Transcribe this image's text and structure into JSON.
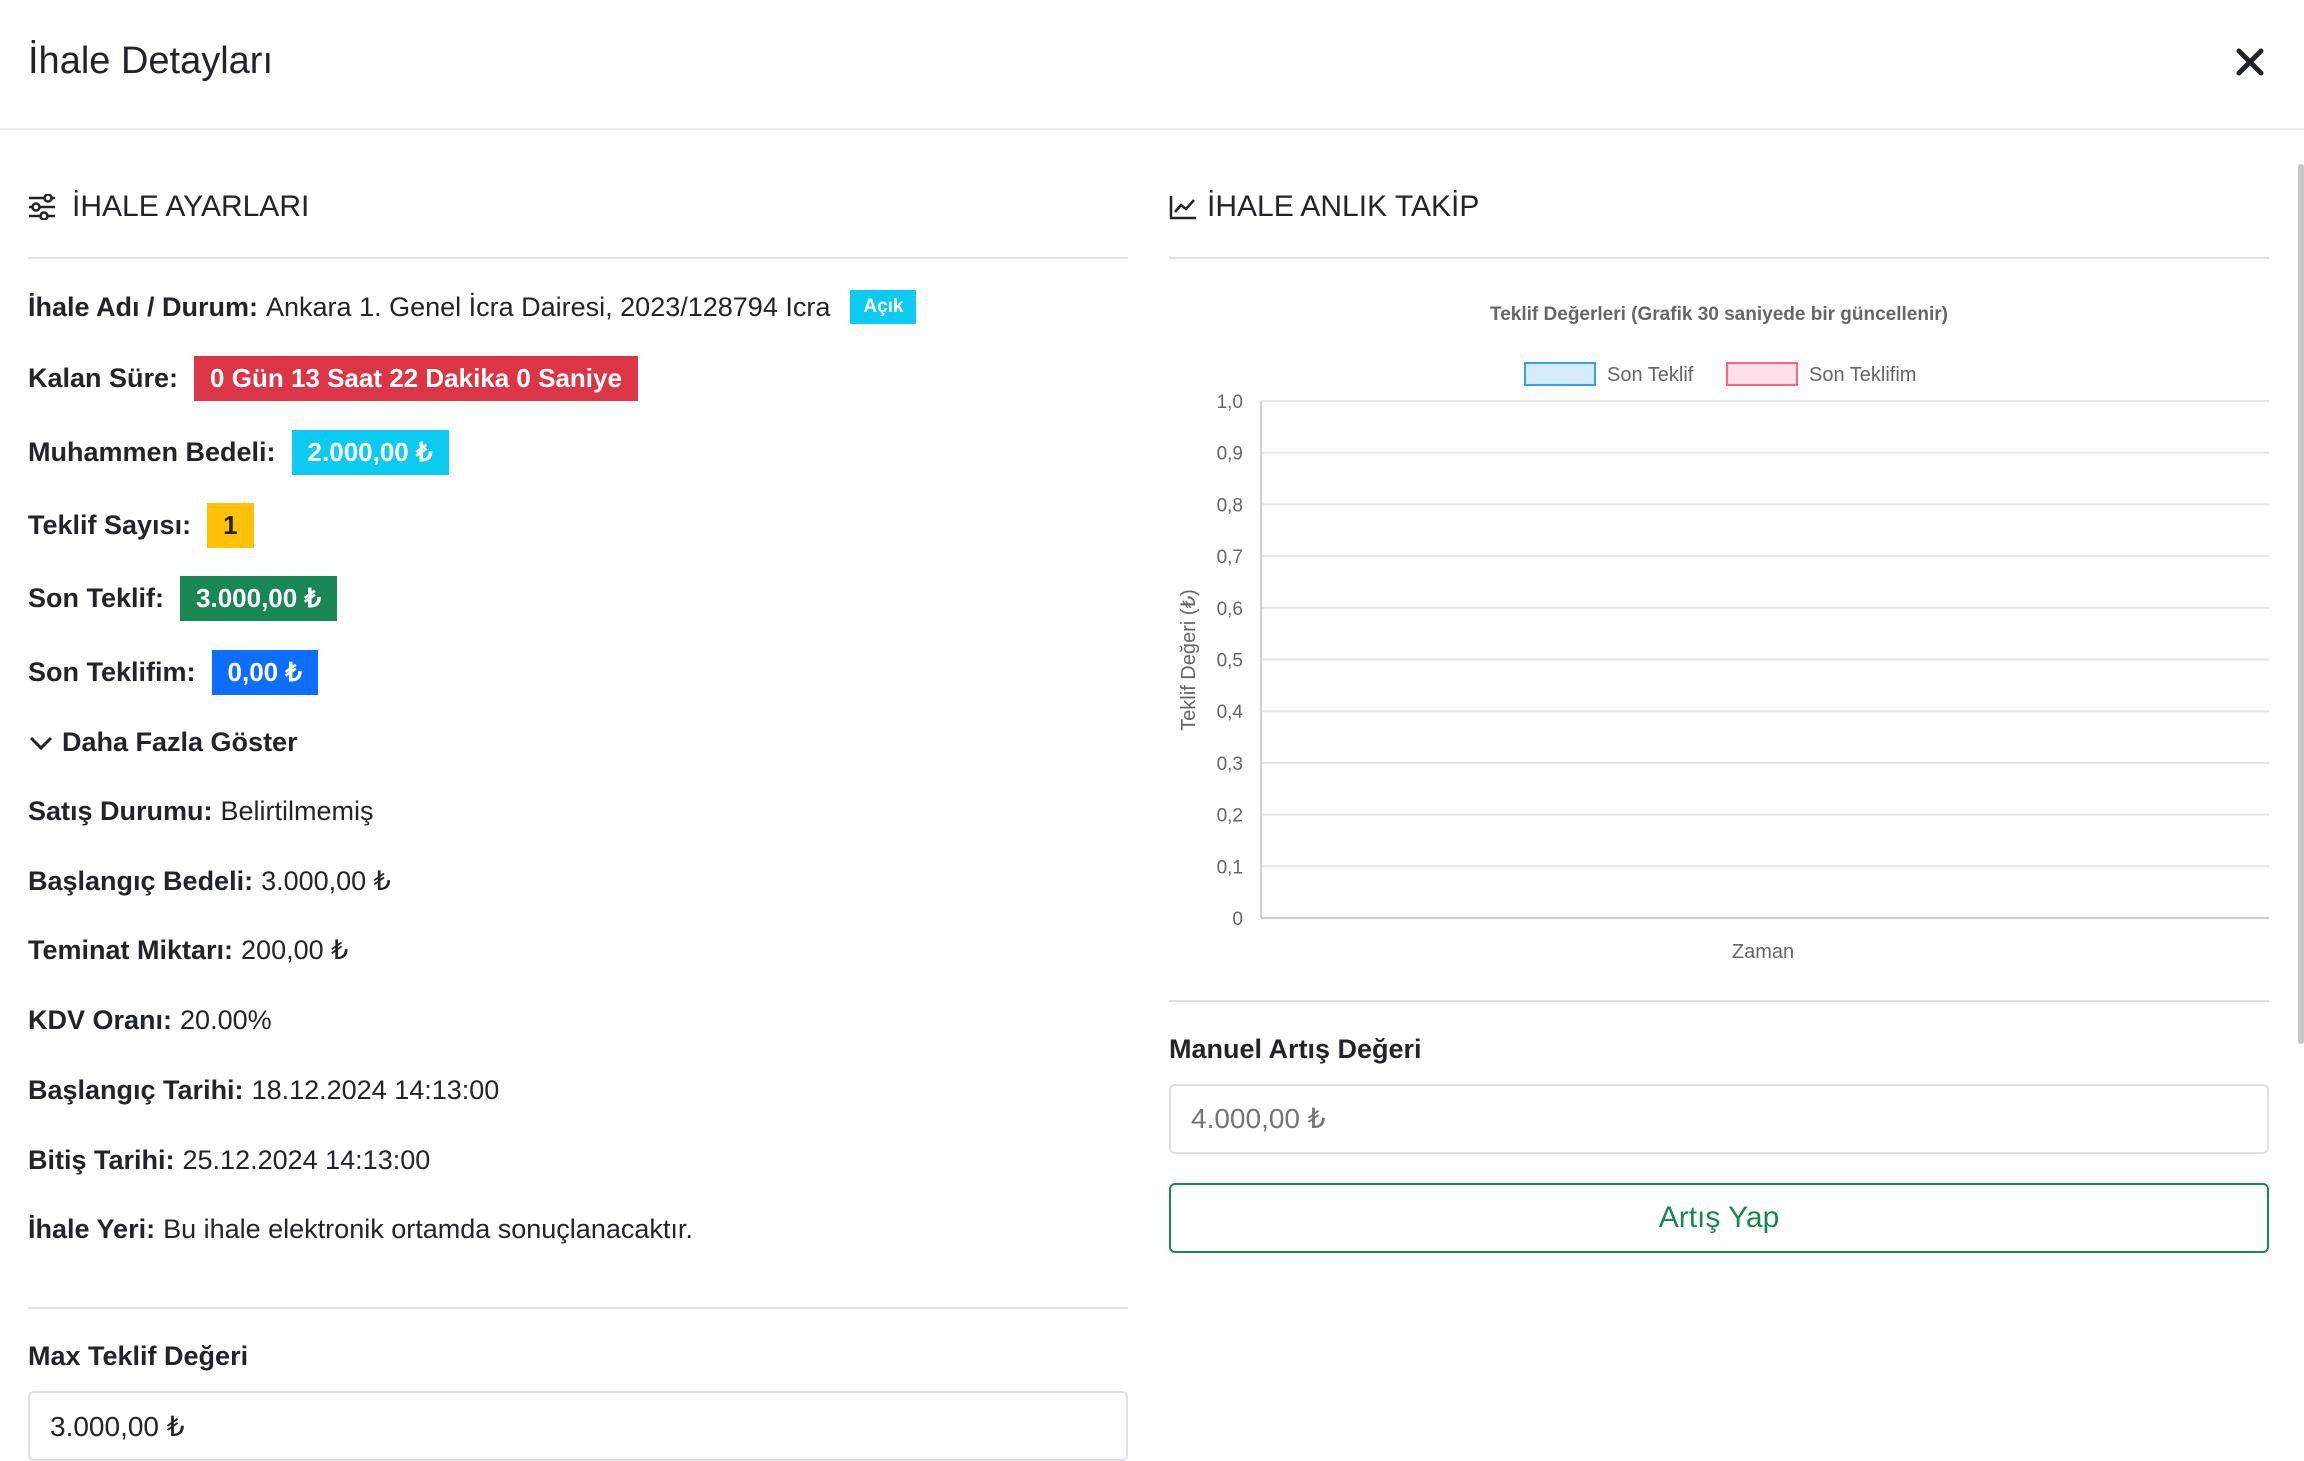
{
  "modal": {
    "title": "İhale Detayları"
  },
  "settings": {
    "title": "İHALE AYARLARI",
    "rows": {
      "name": {
        "label": "İhale Adı / Durum:",
        "value": "Ankara 1. Genel İcra Dairesi, 2023/128794 Icra",
        "status": "Açık"
      },
      "remaining": {
        "label": "Kalan Süre:",
        "value": "0 Gün 13 Saat 22 Dakika 0 Saniye"
      },
      "estimated": {
        "label": "Muhammen Bedeli:",
        "value": "2.000,00 ₺"
      },
      "bid_count": {
        "label": "Teklif Sayısı:",
        "value": "1"
      },
      "last_bid": {
        "label": "Son Teklif:",
        "value": "3.000,00 ₺"
      },
      "my_last_bid": {
        "label": "Son Teklifim:",
        "value": "0,00 ₺"
      }
    },
    "show_more": "Daha Fazla Göster",
    "details": [
      {
        "label": "Satış Durumu:",
        "value": "Belirtilmemiş"
      },
      {
        "label": "Başlangıç Bedeli:",
        "value": "3.000,00 ₺"
      },
      {
        "label": "Teminat Miktarı:",
        "value": "200,00 ₺"
      },
      {
        "label": "KDV Oranı:",
        "value": "20.00%"
      },
      {
        "label": "Başlangıç Tarihi:",
        "value": "18.12.2024 14:13:00"
      },
      {
        "label": "Bitiş Tarihi:",
        "value": "25.12.2024 14:13:00"
      },
      {
        "label": "İhale Yeri:",
        "value": "Bu ihale elektronik ortamda sonuçlanacaktır."
      }
    ],
    "max_bid": {
      "label": "Max Teklif Değeri",
      "value": "3.000,00 ₺"
    }
  },
  "tracking": {
    "title": "İHALE ANLIK TAKİP",
    "manual": {
      "label": "Manuel Artış Değeri",
      "placeholder": "4.000,00 ₺"
    },
    "button": "Artış Yap"
  },
  "colors": {
    "danger": "#dc3545",
    "info": "#0dcaf0",
    "warning": "#ffc107",
    "success": "#198754",
    "primary": "#0d6efd"
  },
  "chart_data": {
    "type": "line",
    "title": "Teklif Değerleri (Grafik 30 saniyede bir güncellenir)",
    "xlabel": "Zaman",
    "ylabel": "Teklif Değeri (₺)",
    "ylim": [
      0,
      1
    ],
    "yticks": [
      "0",
      "0,1",
      "0,2",
      "0,3",
      "0,4",
      "0,5",
      "0,6",
      "0,7",
      "0,8",
      "0,9",
      "1,0"
    ],
    "x": [],
    "series": [
      {
        "name": "Son Teklif",
        "values": [],
        "color": "#36a2eb"
      },
      {
        "name": "Son Teklifim",
        "values": [],
        "color": "#ff6384"
      }
    ],
    "grid": true,
    "legend": "top"
  }
}
